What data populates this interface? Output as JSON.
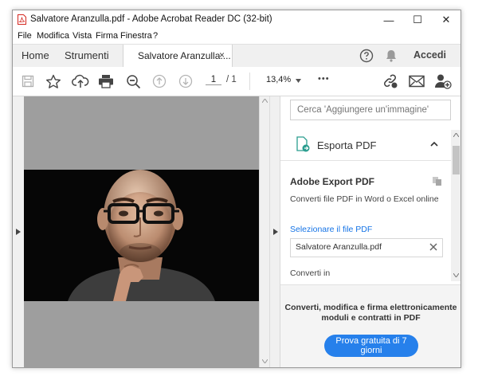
{
  "window": {
    "title": "Salvatore Aranzulla.pdf - Adobe Acrobat Reader DC (32-bit)",
    "minimize_glyph": "—",
    "maximize_glyph": "☐",
    "close_glyph": "✕"
  },
  "menu": [
    "File",
    "Modifica",
    "Vista",
    "Firma",
    "Finestra",
    "?"
  ],
  "tabs": {
    "home": "Home",
    "tools": "Strumenti",
    "document": "Salvatore Aranzulla....",
    "close_glyph": "×",
    "signin": "Accedi"
  },
  "toolbar": {
    "page_current": "1",
    "page_total": "/ 1",
    "zoom": "13,4%",
    "more_glyph": "•••"
  },
  "panel": {
    "search_placeholder": "Cerca 'Aggiungere un'immagine'",
    "export_title": "Esporta PDF",
    "service_title": "Adobe Export PDF",
    "service_desc": "Converti file PDF in Word o Excel online",
    "select_file_link": "Selezionare il file PDF",
    "selected_file": "Salvatore Aranzulla.pdf",
    "convert_label": "Converti in",
    "promo_line1": "Converti, modifica e firma elettronicamente",
    "promo_line2": "moduli e contratti in PDF",
    "trial_button": "Prova gratuita di 7 giorni"
  },
  "colors": {
    "accent": "#2680eb",
    "link": "#1473e6",
    "pdf_red": "#d4261f"
  },
  "icons": [
    "pdf-file-icon",
    "help-icon",
    "bell-icon",
    "save-icon",
    "star-icon",
    "upload-cloud-icon",
    "print-icon",
    "zoom-out-icon",
    "page-up-icon",
    "page-down-icon",
    "share-link-icon",
    "mail-icon",
    "add-user-icon",
    "export-pdf-icon",
    "chevron-up-icon",
    "convert-service-icon",
    "clear-icon"
  ]
}
